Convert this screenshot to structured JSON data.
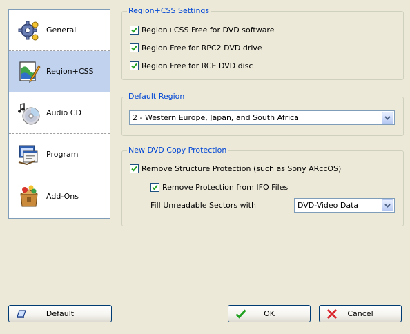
{
  "nav": {
    "items": [
      {
        "label": "General",
        "icon": "gear-icon"
      },
      {
        "label": "Region+CSS",
        "icon": "region-icon"
      },
      {
        "label": "Audio CD",
        "icon": "audio-cd-icon"
      },
      {
        "label": "Program",
        "icon": "program-icon"
      },
      {
        "label": "Add-Ons",
        "icon": "addons-icon"
      }
    ],
    "selected_index": 1
  },
  "region_css": {
    "title": "Region+CSS Settings",
    "options": [
      {
        "label": "Region+CSS Free for DVD software",
        "checked": true
      },
      {
        "label": "Region Free for RPC2 DVD drive",
        "checked": true
      },
      {
        "label": "Region Free for RCE DVD disc",
        "checked": true
      }
    ]
  },
  "default_region": {
    "title": "Default Region",
    "value": "2 - Western Europe, Japan, and South Africa"
  },
  "copy_protection": {
    "title": "New DVD Copy Protection",
    "remove_structure": {
      "label": "Remove Structure Protection (such as Sony ARccOS)",
      "checked": true
    },
    "remove_ifo": {
      "label": "Remove Protection from IFO Files",
      "checked": true
    },
    "fill_label": "Fill Unreadable Sectors with",
    "fill_value": "DVD-Video Data"
  },
  "buttons": {
    "default_label": "Default",
    "ok_label": "OK",
    "cancel_label": "Cancel"
  },
  "colors": {
    "selected_bg": "#c1d2ee",
    "group_title": "#0046d5",
    "window_bg": "#ece9d8",
    "check_green": "#21a121"
  }
}
